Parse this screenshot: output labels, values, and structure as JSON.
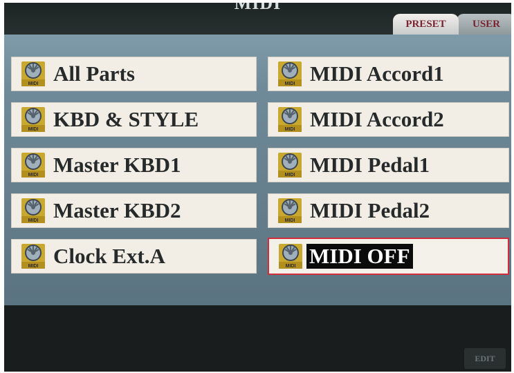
{
  "screen": {
    "title": "MIDI"
  },
  "tabs": [
    {
      "label": "PRESET",
      "active": true
    },
    {
      "label": "USER",
      "active": false
    }
  ],
  "icon": {
    "name": "midi-icon",
    "text": "MIDI"
  },
  "items_left": [
    {
      "label": "All Parts"
    },
    {
      "label": "KBD & STYLE"
    },
    {
      "label": "Master KBD1"
    },
    {
      "label": "Master KBD2"
    },
    {
      "label": "Clock Ext.A"
    }
  ],
  "items_right": [
    {
      "label": "MIDI Accord1"
    },
    {
      "label": "MIDI Accord2"
    },
    {
      "label": "MIDI Pedal1"
    },
    {
      "label": "MIDI Pedal2"
    },
    {
      "label": "MIDI OFF",
      "selected": true
    }
  ],
  "footer": {
    "edit_label": "EDIT"
  },
  "colors": {
    "selection_border": "#d32c3c",
    "tab_text": "#7a2430",
    "panel": "#6f8a99"
  }
}
